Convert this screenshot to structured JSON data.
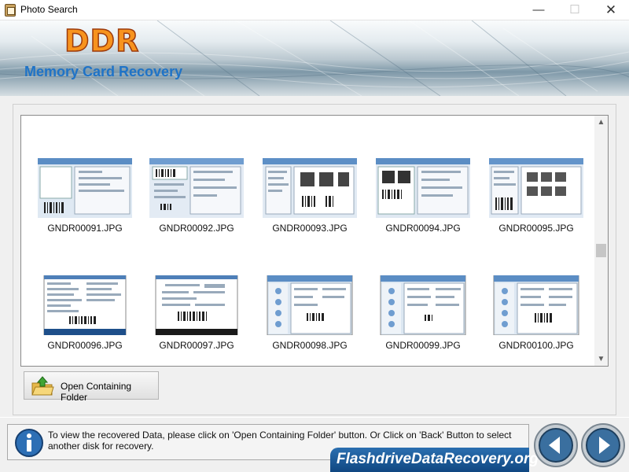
{
  "window": {
    "title": "Photo Search",
    "minimize_symbol": "—",
    "maximize_symbol": "☐",
    "close_symbol": "✕"
  },
  "banner": {
    "logo": "DDR",
    "product_name": "Memory Card Recovery"
  },
  "gallery": {
    "items": [
      {
        "label": "GNDR00091.JPG"
      },
      {
        "label": "GNDR00092.JPG"
      },
      {
        "label": "GNDR00093.JPG"
      },
      {
        "label": "GNDR00094.JPG"
      },
      {
        "label": "GNDR00095.JPG"
      },
      {
        "label": "GNDR00096.JPG"
      },
      {
        "label": "GNDR00097.JPG"
      },
      {
        "label": "GNDR00098.JPG"
      },
      {
        "label": "GNDR00099.JPG"
      },
      {
        "label": "GNDR00100.JPG"
      }
    ],
    "scroll_up_symbol": "▲",
    "scroll_down_symbol": "▼"
  },
  "actions": {
    "open_folder_label": "Open Containing Folder"
  },
  "status": {
    "message": "To view the recovered Data, please click on 'Open Containing Folder' button. Or Click on 'Back' Button to select another disk for recovery."
  },
  "footer": {
    "website": "FlashdriveDataRecovery.org"
  },
  "icons": {
    "app": "app-icon",
    "folder": "folder-open-icon",
    "info": "info-icon",
    "back": "back-arrow-icon",
    "next": "next-arrow-icon"
  },
  "colors": {
    "logo": "#f7931e",
    "product_name": "#1f73c7",
    "footer_badge": "#1a5a97"
  }
}
